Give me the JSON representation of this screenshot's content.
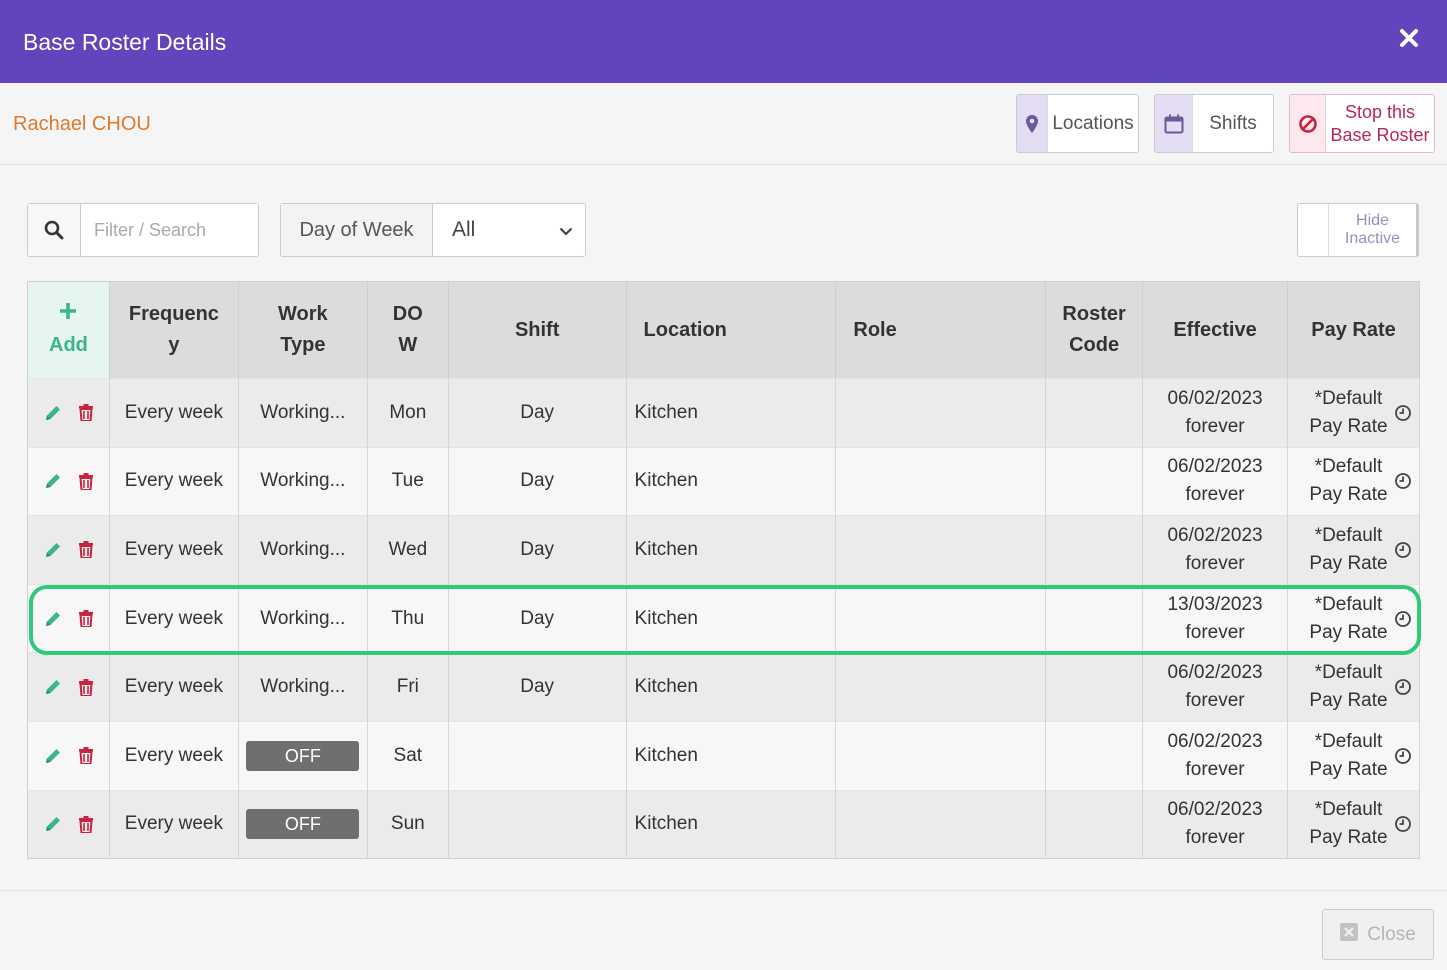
{
  "dialog": {
    "title": "Base Roster Details"
  },
  "user": {
    "name": "Rachael CHOU"
  },
  "header_buttons": {
    "locations": "Locations",
    "shifts": "Shifts",
    "stop_line1": "Stop this",
    "stop_line2": "Base Roster"
  },
  "filters": {
    "search_placeholder": "Filter / Search",
    "dow_label": "Day of Week",
    "dow_selected": "All",
    "hide_inactive_line1": "Hide",
    "hide_inactive_line2": "Inactive"
  },
  "table": {
    "add_label": "Add",
    "columns": {
      "frequency_l1": "Frequenc",
      "frequency_l2": "y",
      "worktype_l1": "Work",
      "worktype_l2": "Type",
      "dow_l1": "DO",
      "dow_l2": "W",
      "shift": "Shift",
      "location": "Location",
      "role": "Role",
      "rostercode_l1": "Roster",
      "rostercode_l2": "Code",
      "effective": "Effective",
      "payrate": "Pay Rate"
    },
    "rows": [
      {
        "frequency": "Every week",
        "work_type": "Working...",
        "off": false,
        "dow": "Mon",
        "shift": "Day",
        "location": "Kitchen",
        "role": "",
        "roster_code": "",
        "effective_date": "06/02/2023",
        "effective_until": "forever",
        "pay_rate_l1": "*Default",
        "pay_rate_l2": "Pay Rate"
      },
      {
        "frequency": "Every week",
        "work_type": "Working...",
        "off": false,
        "dow": "Tue",
        "shift": "Day",
        "location": "Kitchen",
        "role": "",
        "roster_code": "",
        "effective_date": "06/02/2023",
        "effective_until": "forever",
        "pay_rate_l1": "*Default",
        "pay_rate_l2": "Pay Rate"
      },
      {
        "frequency": "Every week",
        "work_type": "Working...",
        "off": false,
        "dow": "Wed",
        "shift": "Day",
        "location": "Kitchen",
        "role": "",
        "roster_code": "",
        "effective_date": "06/02/2023",
        "effective_until": "forever",
        "pay_rate_l1": "*Default",
        "pay_rate_l2": "Pay Rate"
      },
      {
        "frequency": "Every week",
        "work_type": "Working...",
        "off": false,
        "dow": "Thu",
        "shift": "Day",
        "location": "Kitchen",
        "role": "",
        "roster_code": "",
        "effective_date": "13/03/2023",
        "effective_until": "forever",
        "pay_rate_l1": "*Default",
        "pay_rate_l2": "Pay Rate"
      },
      {
        "frequency": "Every week",
        "work_type": "Working...",
        "off": false,
        "dow": "Fri",
        "shift": "Day",
        "location": "Kitchen",
        "role": "",
        "roster_code": "",
        "effective_date": "06/02/2023",
        "effective_until": "forever",
        "pay_rate_l1": "*Default",
        "pay_rate_l2": "Pay Rate"
      },
      {
        "frequency": "Every week",
        "work_type": "OFF",
        "off": true,
        "dow": "Sat",
        "shift": "",
        "location": "Kitchen",
        "role": "",
        "roster_code": "",
        "effective_date": "06/02/2023",
        "effective_until": "forever",
        "pay_rate_l1": "*Default",
        "pay_rate_l2": "Pay Rate"
      },
      {
        "frequency": "Every week",
        "work_type": "OFF",
        "off": true,
        "dow": "Sun",
        "shift": "",
        "location": "Kitchen",
        "role": "",
        "roster_code": "",
        "effective_date": "06/02/2023",
        "effective_until": "forever",
        "pay_rate_l1": "*Default",
        "pay_rate_l2": "Pay Rate"
      }
    ],
    "highlighted_row": 3
  },
  "footer": {
    "close_label": "Close"
  },
  "icons": {
    "close": "close-icon",
    "location": "map-marker-icon",
    "shifts": "calendar-icon",
    "stop": "ban-icon",
    "search": "search-icon",
    "dropdown": "chevron-down-icon",
    "add": "plus-icon",
    "edit": "pencil-icon",
    "delete": "trash-icon",
    "history": "clock-icon"
  },
  "colors": {
    "title_bar": "#6244bc",
    "user_name": "#e07a2c",
    "accent_green": "#3cb58d",
    "delete_red": "#c8233f",
    "stop_red": "#b8265a",
    "highlight": "#2ec97a",
    "off_badge": "#6f6f6f"
  }
}
